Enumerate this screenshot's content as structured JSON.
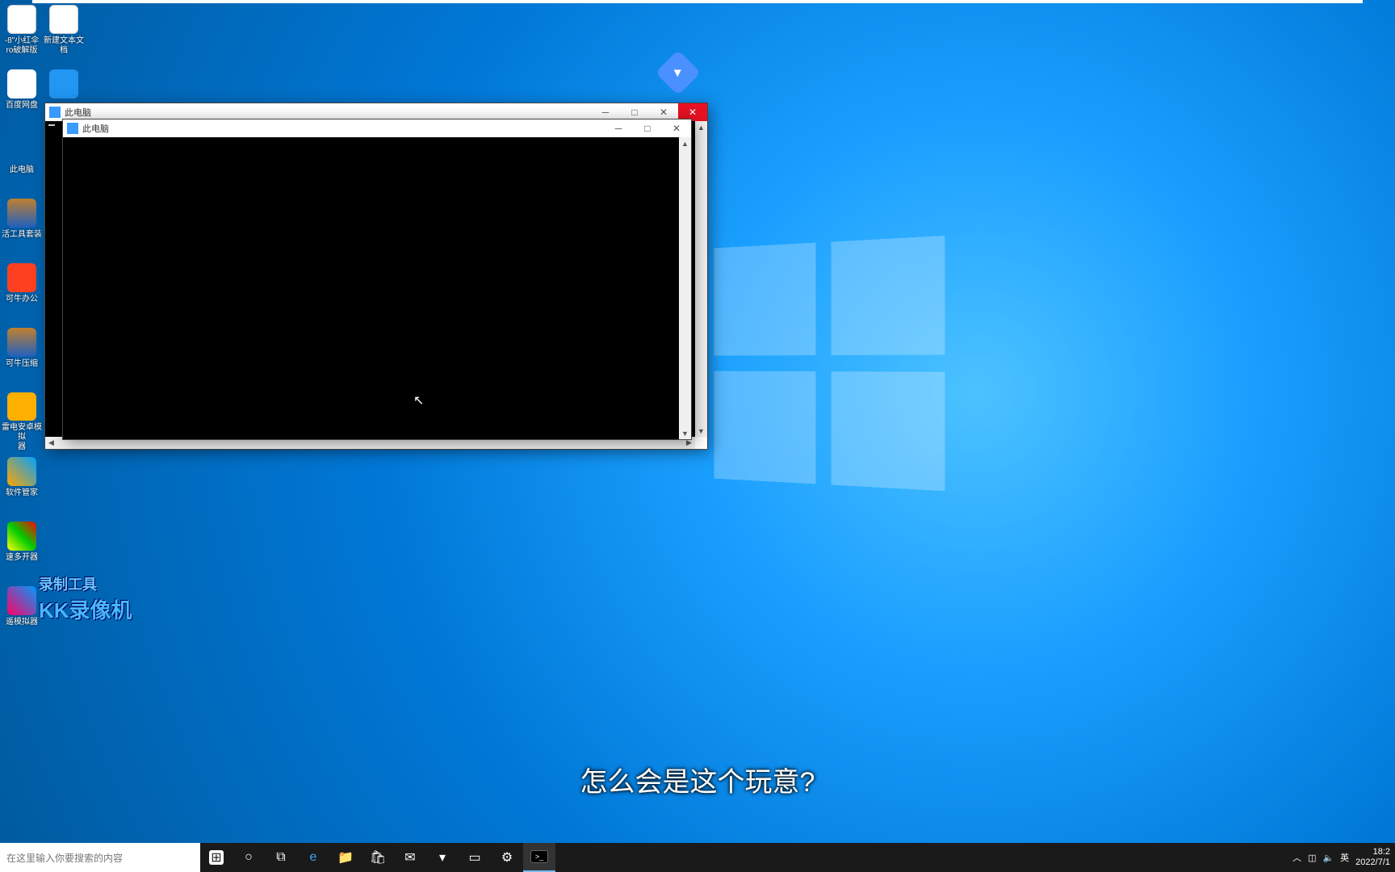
{
  "desktop_icons_col1": [
    {
      "name": "xiaohongsan",
      "label": "-8\"小红伞\nro破解版",
      "cls": "ic-txt"
    },
    {
      "name": "baidupan",
      "label": "百度网盘",
      "cls": "ic-pan"
    },
    {
      "name": "thispc",
      "label": "此电脑",
      "cls": "ic-pc"
    },
    {
      "name": "toolkit",
      "label": "活工具套装",
      "cls": "ic-zip"
    },
    {
      "name": "keniubg",
      "label": "可牛办公",
      "cls": "ic-kn"
    },
    {
      "name": "keniuzip",
      "label": "可牛压缩",
      "cls": "ic-zip2"
    },
    {
      "name": "ldplayer",
      "label": "雷电安卓模拟\n器",
      "cls": "ic-ld"
    },
    {
      "name": "appmgr",
      "label": "软件管家",
      "cls": "ic-app"
    },
    {
      "name": "multiopen",
      "label": "速多开器",
      "cls": "ic-acc"
    },
    {
      "name": "xyplayer",
      "label": "遥模拟器",
      "cls": "ic-xy"
    }
  ],
  "desktop_icons_col2": [
    {
      "name": "newtxt",
      "label": "新建文本文档",
      "cls": "ic-txt"
    },
    {
      "name": "thunder",
      "label": "",
      "cls": "ic-bird"
    }
  ],
  "window1": {
    "title": "此电脑"
  },
  "window2": {
    "title": "此电脑"
  },
  "watermark": {
    "line1": "录制工具",
    "line2": "KK录像机"
  },
  "subtitle": "怎么会是这个玩意?",
  "taskbar": {
    "search_placeholder": "在这里输入你要搜索的内容",
    "items": [
      {
        "name": "start",
        "glyph": "⊞"
      },
      {
        "name": "cortana",
        "glyph": "○"
      },
      {
        "name": "taskview",
        "glyph": "⧉"
      },
      {
        "name": "edge",
        "glyph": "e"
      },
      {
        "name": "explorer",
        "glyph": "📁"
      },
      {
        "name": "store",
        "glyph": "🛍"
      },
      {
        "name": "mail",
        "glyph": "✉"
      },
      {
        "name": "thunder",
        "glyph": "▾"
      },
      {
        "name": "notes",
        "glyph": "▭"
      },
      {
        "name": "settings",
        "glyph": "⚙"
      },
      {
        "name": "cmd",
        "glyph": ">_",
        "active": true
      }
    ]
  },
  "tray": {
    "chevron": "︿",
    "net": "◫",
    "vol": "🔈",
    "ime": "英",
    "time": "18:2",
    "date": "2022/7/1"
  }
}
